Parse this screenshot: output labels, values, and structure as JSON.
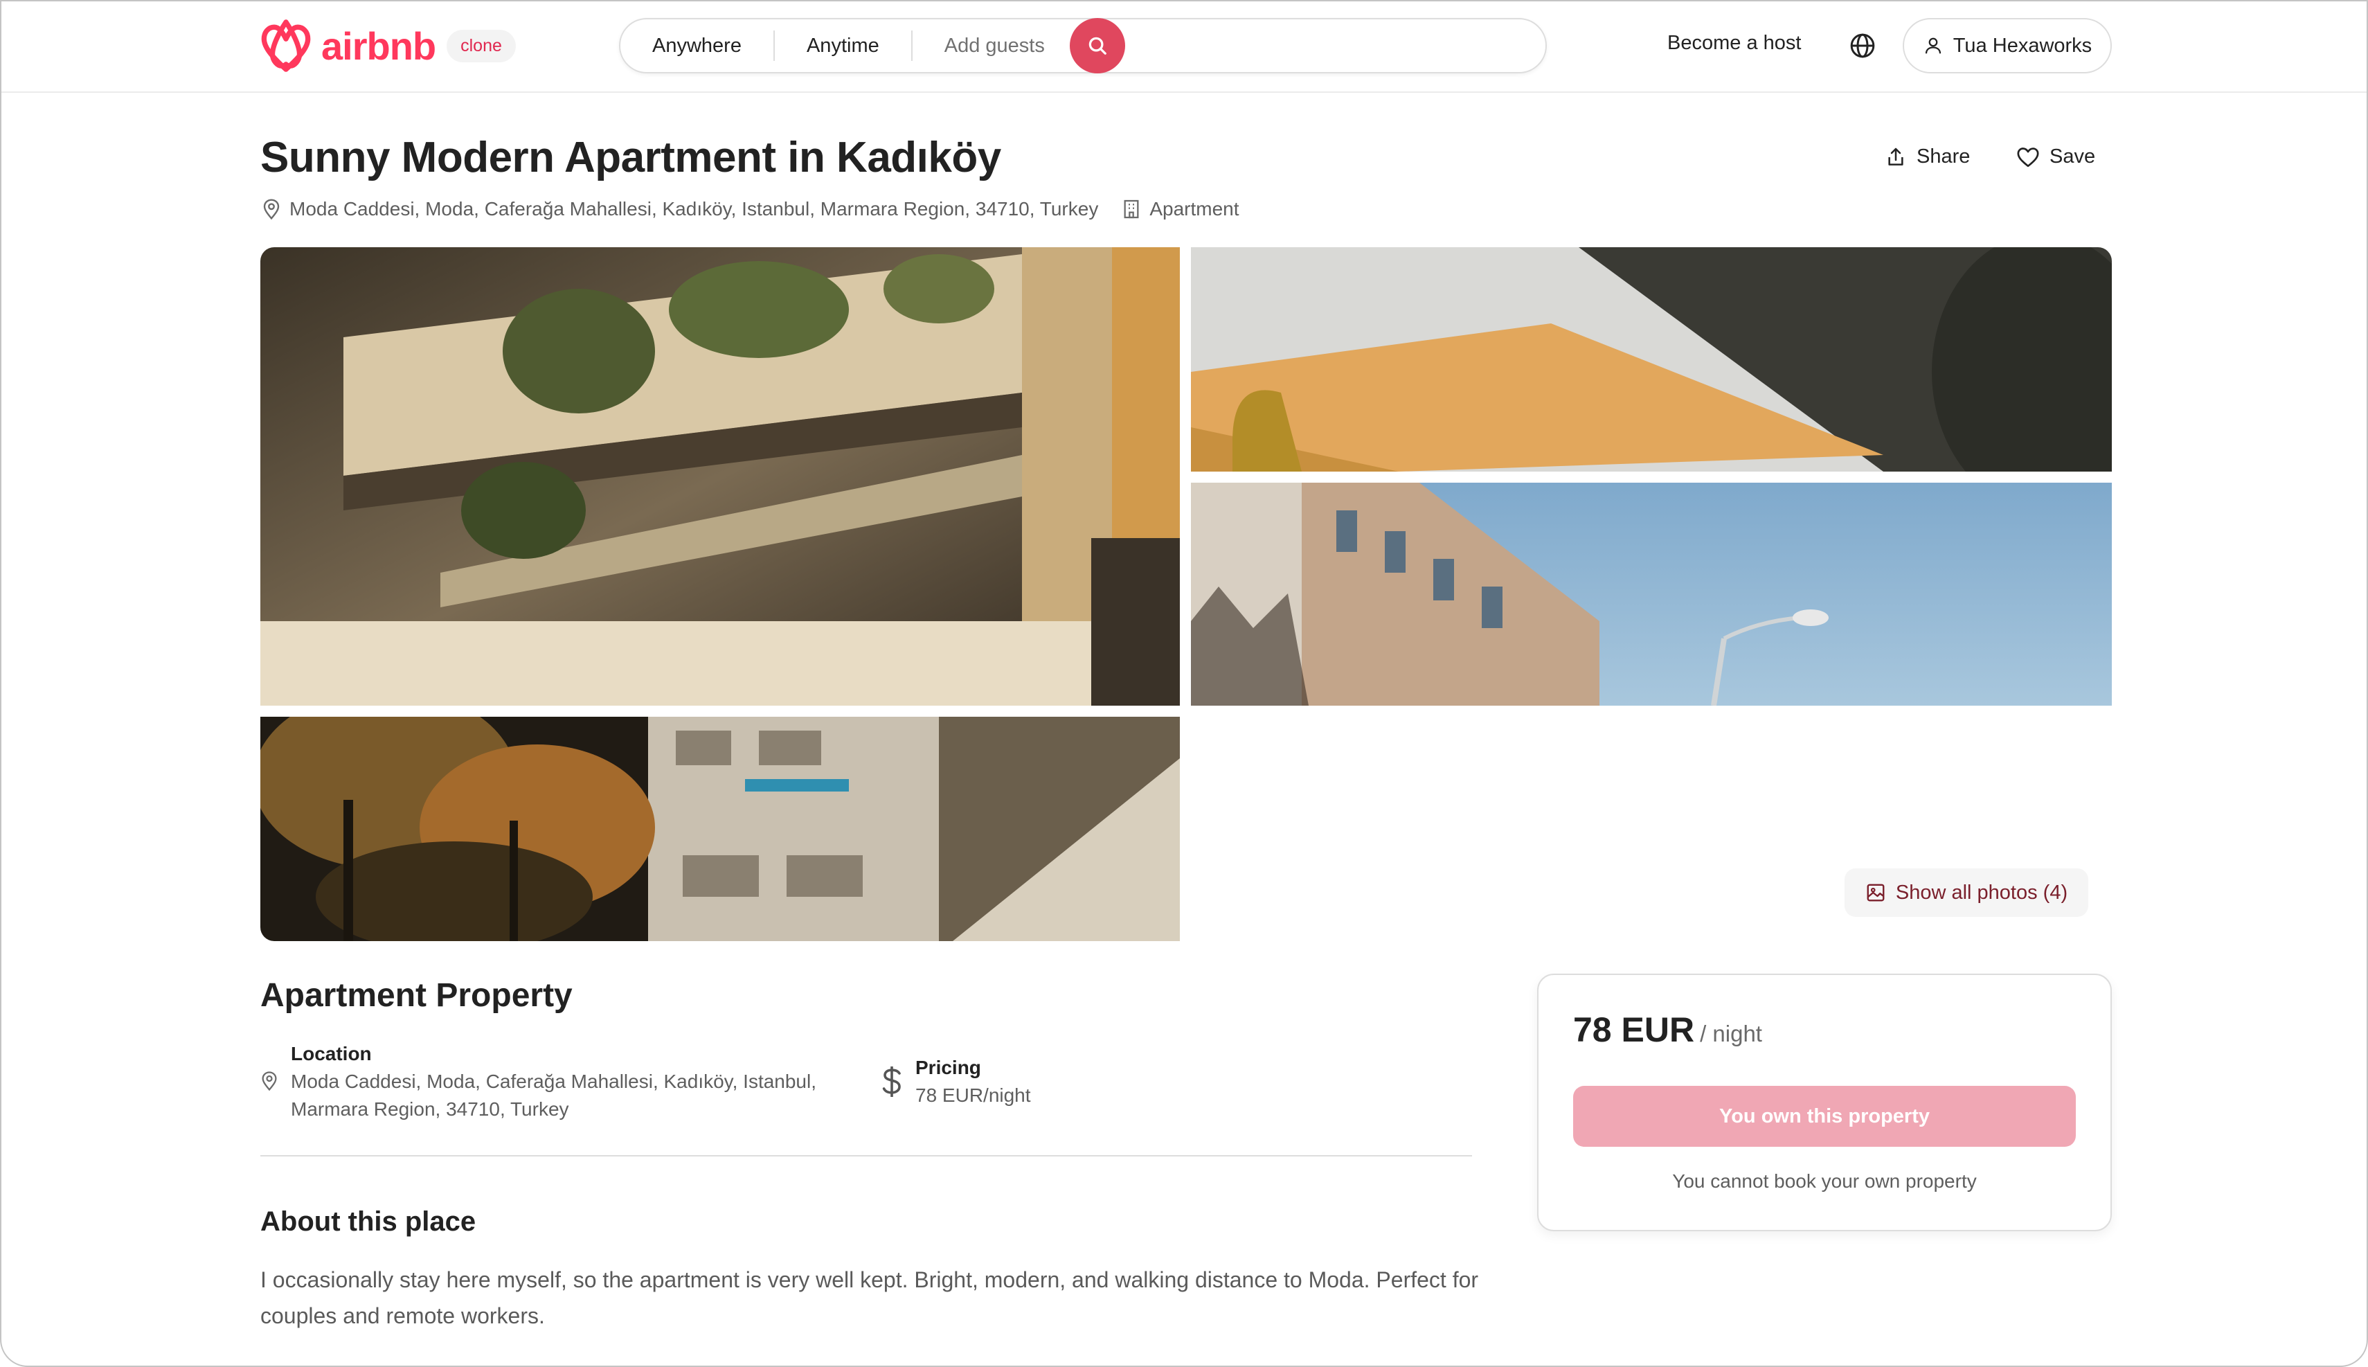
{
  "header": {
    "brand": "airbnb",
    "badge": "clone",
    "search": {
      "where": "Anywhere",
      "when": "Anytime",
      "guests": "Add guests"
    },
    "become_host": "Become a host",
    "user_name": "Tua Hexaworks"
  },
  "listing": {
    "title": "Sunny Modern Apartment in Kadıköy",
    "share_label": "Share",
    "save_label": "Save",
    "address": "Moda Caddesi, Moda, Caferağa Mahallesi, Kadıköy, Istanbul, Marmara Region, 34710, Turkey",
    "type": "Apartment",
    "show_photos_label": "Show all photos (4)"
  },
  "details": {
    "heading": "Apartment Property",
    "location_label": "Location",
    "location_line1": "Moda Caddesi, Moda, Caferağa Mahallesi, Kadıköy, Istanbul,",
    "location_line2": "Marmara Region, 34710, Turkey",
    "pricing_label": "Pricing",
    "pricing_value": "78 EUR/night",
    "about_heading": "About this place",
    "about_text": "I occasionally stay here myself, so the apartment is very well kept. Bright, modern, and walking distance to Moda. Perfect for couples and remote workers."
  },
  "booking": {
    "price": "78 EUR",
    "unit": "/ night",
    "button_label": "You own this property",
    "note": "You cannot book your own property"
  },
  "colors": {
    "brand": "#ff385c",
    "search_button": "#e0475e",
    "owned_button": "#f0a7b4"
  }
}
